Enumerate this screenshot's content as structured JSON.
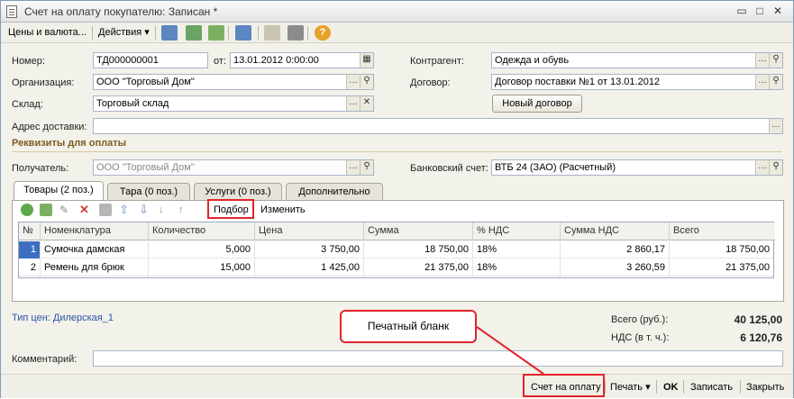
{
  "window": {
    "title": "Счет на оплату покупателю: Записан *"
  },
  "toolbar": {
    "prices": "Цены и валюта...",
    "actions": "Действия"
  },
  "form": {
    "number_label": "Номер:",
    "number": "ТД000000001",
    "date_label": "от:",
    "date": "13.01.2012  0:00:00",
    "org_label": "Организация:",
    "org": "ООО \"Торговый Дом\"",
    "warehouse_label": "Склад:",
    "warehouse": "Торговый склад",
    "address_label": "Адрес доставки:",
    "address": "",
    "contragent_label": "Контрагент:",
    "contragent": "Одежда и обувь",
    "contract_label": "Договор:",
    "contract": "Договор поставки №1 от 13.01.2012",
    "new_contract": "Новый договор"
  },
  "payment": {
    "section": "Реквизиты для оплаты",
    "recipient_label": "Получатель:",
    "recipient": "ООО \"Торговый Дом\"",
    "bank_label": "Банковский счет:",
    "bank": "ВТБ 24 (ЗАО) (Расчетный)"
  },
  "tabs": [
    "Товары (2 поз.)",
    "Тара (0 поз.)",
    "Услуги (0 поз.)",
    "Дополнительно"
  ],
  "tabtoolbar": {
    "select": "Подбор",
    "change": "Изменить"
  },
  "table": {
    "headers": [
      "№",
      "Номенклатура",
      "Количество",
      "Цена",
      "Сумма",
      "% НДС",
      "Сумма НДС",
      "Всего"
    ],
    "rows": [
      [
        "1",
        "Сумочка дамская",
        "5,000",
        "3 750,00",
        "18 750,00",
        "18%",
        "2 860,17",
        "18 750,00"
      ],
      [
        "2",
        "Ремень для брюк",
        "15,000",
        "1 425,00",
        "21 375,00",
        "18%",
        "3 260,59",
        "21 375,00"
      ]
    ]
  },
  "footer": {
    "price_type": "Тип цен: Дилерская_1",
    "total_label": "Всего (руб.):",
    "total": "40 125,00",
    "vat_label": "НДС (в т. ч.):",
    "vat": "6 120,76",
    "comment_label": "Комментарий:",
    "comment": ""
  },
  "callout": "Печатный бланк",
  "bottom": {
    "invoice": "Счет на оплату",
    "print": "Печать",
    "ok": "OK",
    "save": "Записать",
    "close": "Закрыть"
  },
  "colors": {
    "highlight_red": "#e2242a",
    "section_title": "#7a5c1d"
  }
}
